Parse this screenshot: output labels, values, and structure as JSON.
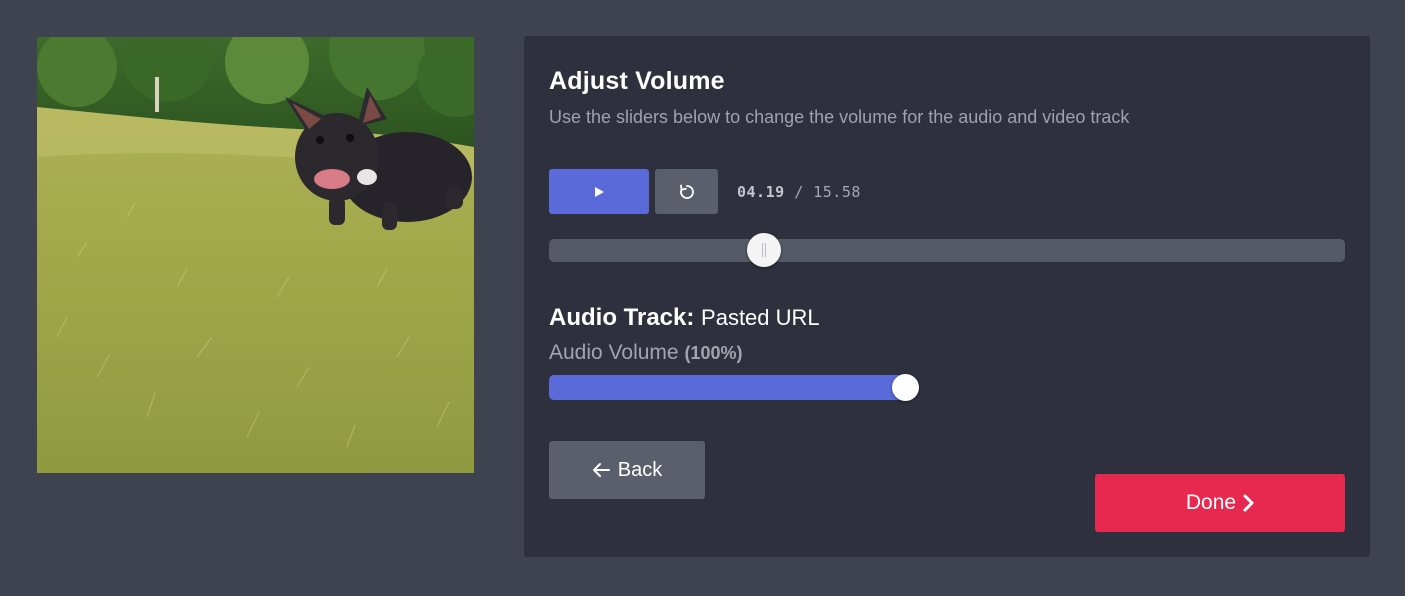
{
  "editor": {
    "title": "Adjust Volume",
    "subtitle": "Use the sliders below to change the volume for the audio and video track"
  },
  "player": {
    "play_icon": "play-icon",
    "reset_icon": "restart-icon",
    "current_time": "04.19",
    "separator": "/",
    "total_time": "15.58",
    "seek_position_fraction": 0.27
  },
  "audio": {
    "track_label": "Audio Track:",
    "track_value": "Pasted URL",
    "volume_label": "Audio Volume",
    "volume_percent_text": "(100%)",
    "volume_fraction": 1.0
  },
  "actions": {
    "back_label": "Back",
    "back_icon": "arrow-left-icon",
    "done_label": "Done",
    "done_icon": "chevron-right-icon"
  },
  "colors": {
    "background": "#3f434f",
    "panel": "#2e313d",
    "accent": "#5a6ad9",
    "done": "#e8294f",
    "secondary_button": "#5b5e6b"
  }
}
